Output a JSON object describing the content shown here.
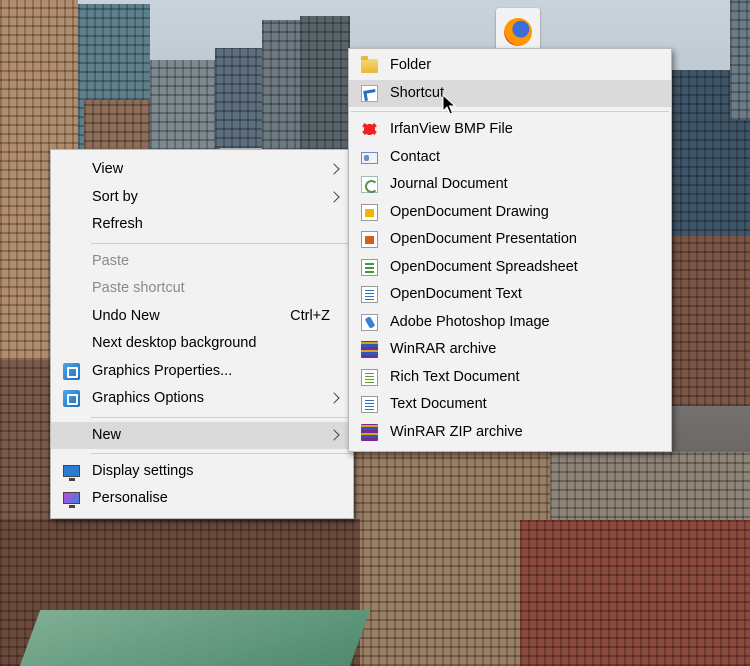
{
  "context_menu": {
    "items": [
      {
        "label": "View",
        "submenu": true
      },
      {
        "label": "Sort by",
        "submenu": true
      },
      {
        "label": "Refresh"
      },
      {
        "label": "Paste",
        "disabled": true
      },
      {
        "label": "Paste shortcut",
        "disabled": true
      },
      {
        "label": "Undo New",
        "shortcut": "Ctrl+Z"
      },
      {
        "label": "Next desktop background"
      },
      {
        "label": "Graphics Properties...",
        "icon": "graphics-icon"
      },
      {
        "label": "Graphics Options",
        "icon": "graphics-icon",
        "submenu": true
      },
      {
        "label": "New",
        "submenu": true,
        "highlighted": true
      },
      {
        "label": "Display settings",
        "icon": "display-icon"
      },
      {
        "label": "Personalise",
        "icon": "personalise-icon"
      }
    ]
  },
  "new_submenu": {
    "items": [
      {
        "label": "Folder",
        "icon": "folder-icon"
      },
      {
        "label": "Shortcut",
        "icon": "shortcut-icon",
        "highlighted": true
      },
      {
        "label": "IrfanView BMP File",
        "icon": "irfanview-icon"
      },
      {
        "label": "Contact",
        "icon": "contact-icon"
      },
      {
        "label": "Journal Document",
        "icon": "journal-icon"
      },
      {
        "label": "OpenDocument Drawing",
        "icon": "odg-icon"
      },
      {
        "label": "OpenDocument Presentation",
        "icon": "odp-icon"
      },
      {
        "label": "OpenDocument Spreadsheet",
        "icon": "ods-icon"
      },
      {
        "label": "OpenDocument Text",
        "icon": "odt-icon"
      },
      {
        "label": "Adobe Photoshop Image",
        "icon": "photoshop-icon"
      },
      {
        "label": "WinRAR archive",
        "icon": "winrar-icon"
      },
      {
        "label": "Rich Text Document",
        "icon": "rtf-icon"
      },
      {
        "label": "Text Document",
        "icon": "text-document-icon"
      },
      {
        "label": "WinRAR ZIP archive",
        "icon": "winrar-zip-icon"
      }
    ]
  },
  "desktop": {
    "icons": [
      "firefox-icon"
    ]
  },
  "colors": {
    "menu_bg": "#f2f2f2",
    "menu_hover": "#dadada",
    "disabled_text": "#8a8a8a"
  }
}
